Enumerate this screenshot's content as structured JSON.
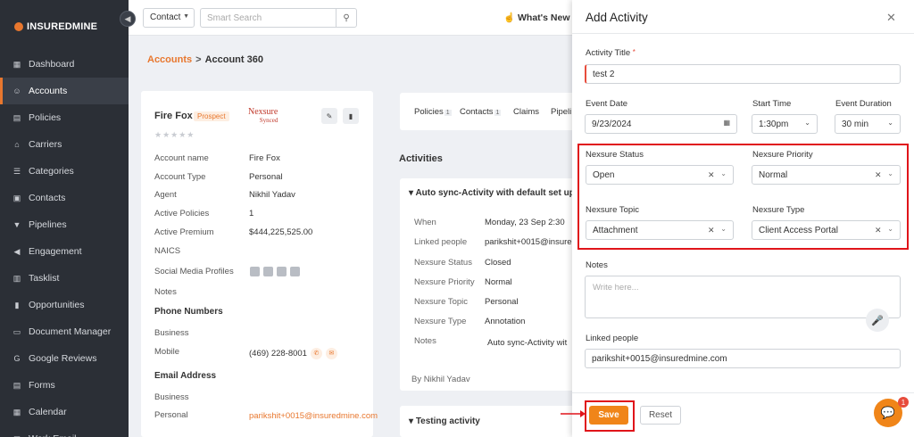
{
  "brand": {
    "name": "INSUREDMINE"
  },
  "sidebar": {
    "items": [
      {
        "label": "Dashboard",
        "icon": "dashboard-icon",
        "glyph": "▦"
      },
      {
        "label": "Accounts",
        "icon": "users-icon",
        "glyph": "☺"
      },
      {
        "label": "Policies",
        "icon": "document-icon",
        "glyph": "▤"
      },
      {
        "label": "Carriers",
        "icon": "bank-icon",
        "glyph": "⌂"
      },
      {
        "label": "Categories",
        "icon": "list-icon",
        "glyph": "☰"
      },
      {
        "label": "Contacts",
        "icon": "contact-card-icon",
        "glyph": "▣"
      },
      {
        "label": "Pipelines",
        "icon": "funnel-icon",
        "glyph": "▼"
      },
      {
        "label": "Engagement",
        "icon": "megaphone-icon",
        "glyph": "◀"
      },
      {
        "label": "Tasklist",
        "icon": "tasklist-icon",
        "glyph": "▥"
      },
      {
        "label": "Opportunities",
        "icon": "bar-chart-icon",
        "glyph": "▮"
      },
      {
        "label": "Document Manager",
        "icon": "folder-icon",
        "glyph": "▭"
      },
      {
        "label": "Google Reviews",
        "icon": "google-icon",
        "glyph": "G"
      },
      {
        "label": "Forms",
        "icon": "form-icon",
        "glyph": "▤"
      },
      {
        "label": "Calendar",
        "icon": "calendar-icon",
        "glyph": "▦"
      },
      {
        "label": "Work Email",
        "icon": "mail-icon",
        "glyph": "✉"
      }
    ],
    "active_index": 1
  },
  "topbar": {
    "contact_select": "Contact",
    "search_placeholder": "Smart Search",
    "whats_new": "What's New"
  },
  "breadcrumb": {
    "parent": "Accounts",
    "sep": ">",
    "current": "Account 360"
  },
  "account": {
    "name": "Fire Fox",
    "badge": "Prospect",
    "stars": "★★★★★",
    "carrier_logo": "Nexsure",
    "carrier_logo_sub": "Synced",
    "rows": [
      {
        "label": "Account name",
        "value": "Fire Fox"
      },
      {
        "label": "Account Type",
        "value": "Personal"
      },
      {
        "label": "Agent",
        "value": "Nikhil Yadav"
      },
      {
        "label": "Active Policies",
        "value": "1"
      },
      {
        "label": "Active Premium",
        "value": "$444,225,525.00"
      },
      {
        "label": "NAICS",
        "value": ""
      },
      {
        "label": "Social Media Profiles",
        "value": ""
      },
      {
        "label": "Notes",
        "value": ""
      }
    ],
    "phone_heading": "Phone Numbers",
    "phone_rows": [
      {
        "label": "Business",
        "value": ""
      },
      {
        "label": "Mobile",
        "value": "(469) 228-8001"
      }
    ],
    "email_heading": "Email Address",
    "email_rows": [
      {
        "label": "Business",
        "value": ""
      },
      {
        "label": "Personal",
        "value": "parikshit+0015@insuredmine.com"
      }
    ]
  },
  "tabs": [
    {
      "label": "Policies",
      "count": "1"
    },
    {
      "label": "Contacts",
      "count": "1"
    },
    {
      "label": "Claims",
      "count": ""
    },
    {
      "label": "Pipeli",
      "count": ""
    }
  ],
  "activities": {
    "title": "Activities",
    "card1_title": "Auto sync-Activity with default set up",
    "rows": [
      {
        "label": "When",
        "value": "Monday, 23 Sep    2:30"
      },
      {
        "label": "Linked people",
        "value": "parikshit+0015@insure"
      },
      {
        "label": "Nexsure Status",
        "value": "Closed"
      },
      {
        "label": "Nexsure Priority",
        "value": "Normal"
      },
      {
        "label": "Nexsure Topic",
        "value": "Personal"
      },
      {
        "label": "Nexsure Type",
        "value": "Annotation"
      },
      {
        "label": "Notes",
        "value": "Auto sync-Activity wit"
      }
    ],
    "by": "By Nikhil Yadav",
    "card2_title": "Testing activity"
  },
  "panel": {
    "title": "Add Activity",
    "activity_title_label": "Activity Title",
    "activity_title_value": "test 2",
    "event_date_label": "Event Date",
    "event_date_value": "9/23/2024",
    "start_time_label": "Start Time",
    "start_time_value": "1:30pm",
    "event_duration_label": "Event Duration",
    "event_duration_value": "30 min",
    "nexsure_status_label": "Nexsure Status",
    "nexsure_status_value": "Open",
    "nexsure_priority_label": "Nexsure Priority",
    "nexsure_priority_value": "Normal",
    "nexsure_topic_label": "Nexsure Topic",
    "nexsure_topic_value": "Attachment",
    "nexsure_type_label": "Nexsure Type",
    "nexsure_type_value": "Client Access Portal",
    "notes_label": "Notes",
    "notes_placeholder": "Write here...",
    "linked_people_label": "Linked people",
    "linked_people_value": "parikshit+0015@insuredmine.com",
    "save_label": "Save",
    "reset_label": "Reset"
  },
  "chat": {
    "badge": "1"
  },
  "colors": {
    "accent": "#f08519",
    "highlight": "#e0141a",
    "sidebar_bg": "#2b2f36"
  }
}
